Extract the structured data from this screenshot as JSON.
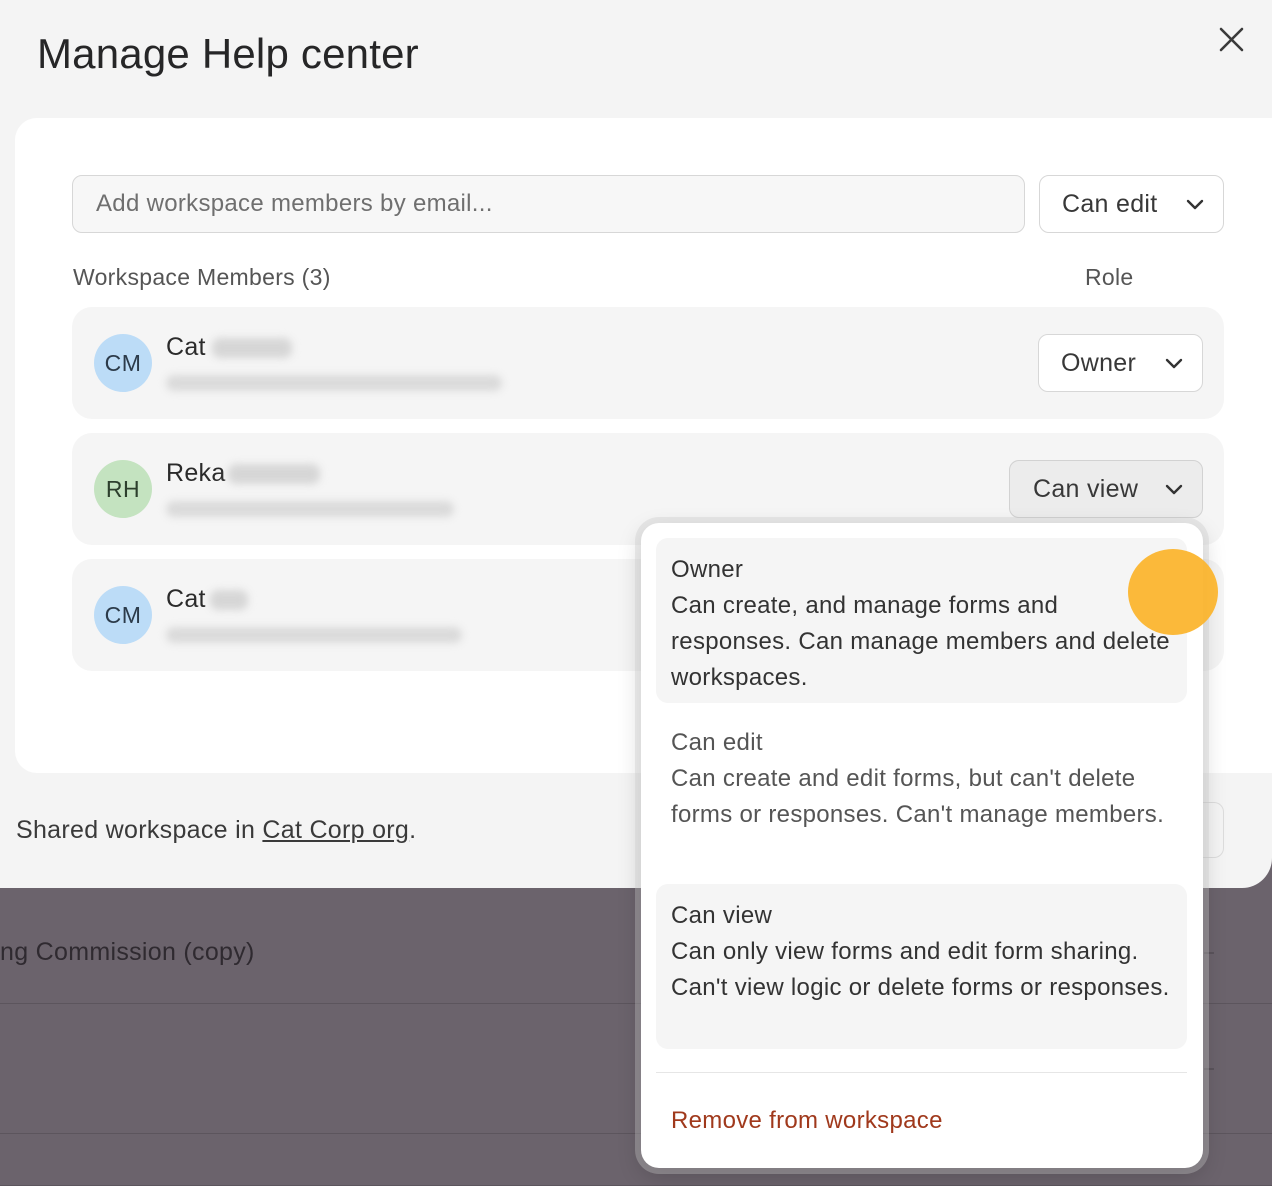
{
  "background": {
    "row_title": "ng Commission (copy)"
  },
  "modal": {
    "title": "Manage Help center",
    "close_icon": "close-icon"
  },
  "invite": {
    "placeholder": "Add workspace members by email...",
    "role": "Can edit"
  },
  "members_header": {
    "label": "Workspace Members (3)",
    "role_label": "Role"
  },
  "members": [
    {
      "initials": "CM",
      "first_name": "Cat",
      "avatar_color": "#bcdcf7",
      "role": "Owner"
    },
    {
      "initials": "RH",
      "first_name": "Reka",
      "avatar_color": "#c4e3c0",
      "role": "Can view"
    },
    {
      "initials": "CM",
      "first_name": "Cat",
      "avatar_color": "#bcdcf7"
    }
  ],
  "footer": {
    "prefix": "Shared workspace in ",
    "org_link": "Cat Corp org",
    "suffix": "."
  },
  "role_menu": {
    "options": [
      {
        "title": "Owner",
        "description": "Can create, and manage forms and responses. Can manage members and delete workspaces."
      },
      {
        "title": "Can edit",
        "description": "Can create and edit forms, but can't delete forms or responses. Can't manage members."
      },
      {
        "title": "Can view",
        "description": "Can only view forms and edit form sharing. Can't view logic or delete forms or responses."
      }
    ],
    "remove_label": "Remove from workspace"
  },
  "colors": {
    "remove_text": "#a0391c",
    "cursor_highlight": "#fbb52f"
  }
}
